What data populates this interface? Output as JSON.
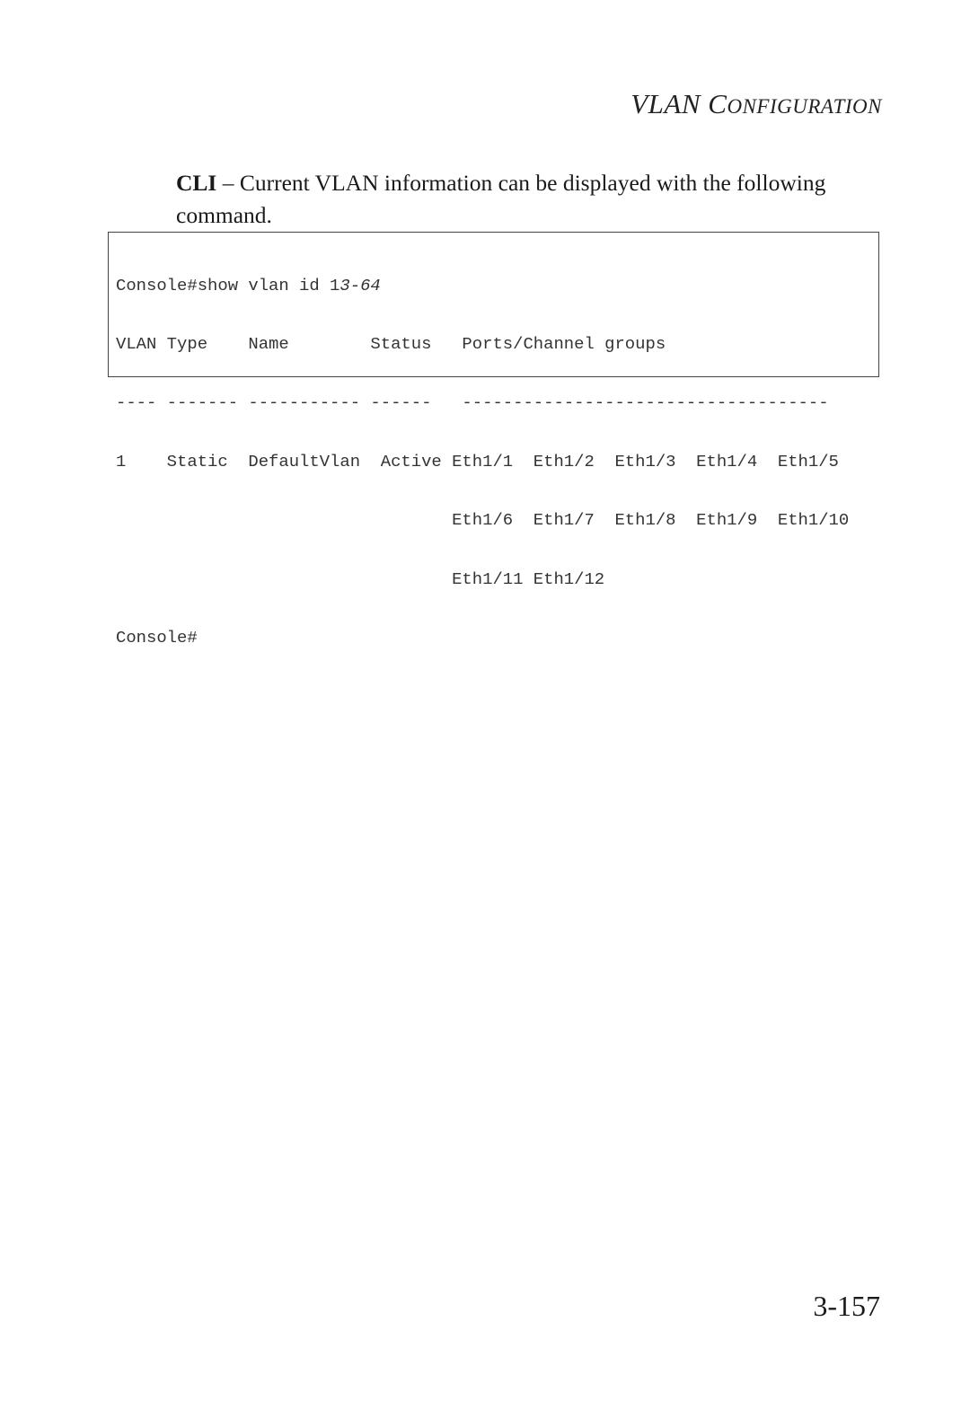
{
  "header": {
    "section_title_lead": "VLAN C",
    "section_title_rest": "ONFIGURATION"
  },
  "intro": {
    "lead": "CLI",
    "separator": " – ",
    "text": "Current VLAN information can be displayed with the following command."
  },
  "console": {
    "command_prefix": "Console#show vlan id 1",
    "command_arg": "3-64",
    "lines": [
      "VLAN Type    Name        Status   Ports/Channel groups",
      "---- ------- ----------- ------   ------------------------------------",
      "1    Static  DefaultVlan  Active Eth1/1  Eth1/2  Eth1/3  Eth1/4  Eth1/5",
      "                                 Eth1/6  Eth1/7  Eth1/8  Eth1/9  Eth1/10",
      "                                 Eth1/11 Eth1/12"
    ],
    "prompt": "Console#"
  },
  "footer": {
    "page_number": "3-157"
  }
}
